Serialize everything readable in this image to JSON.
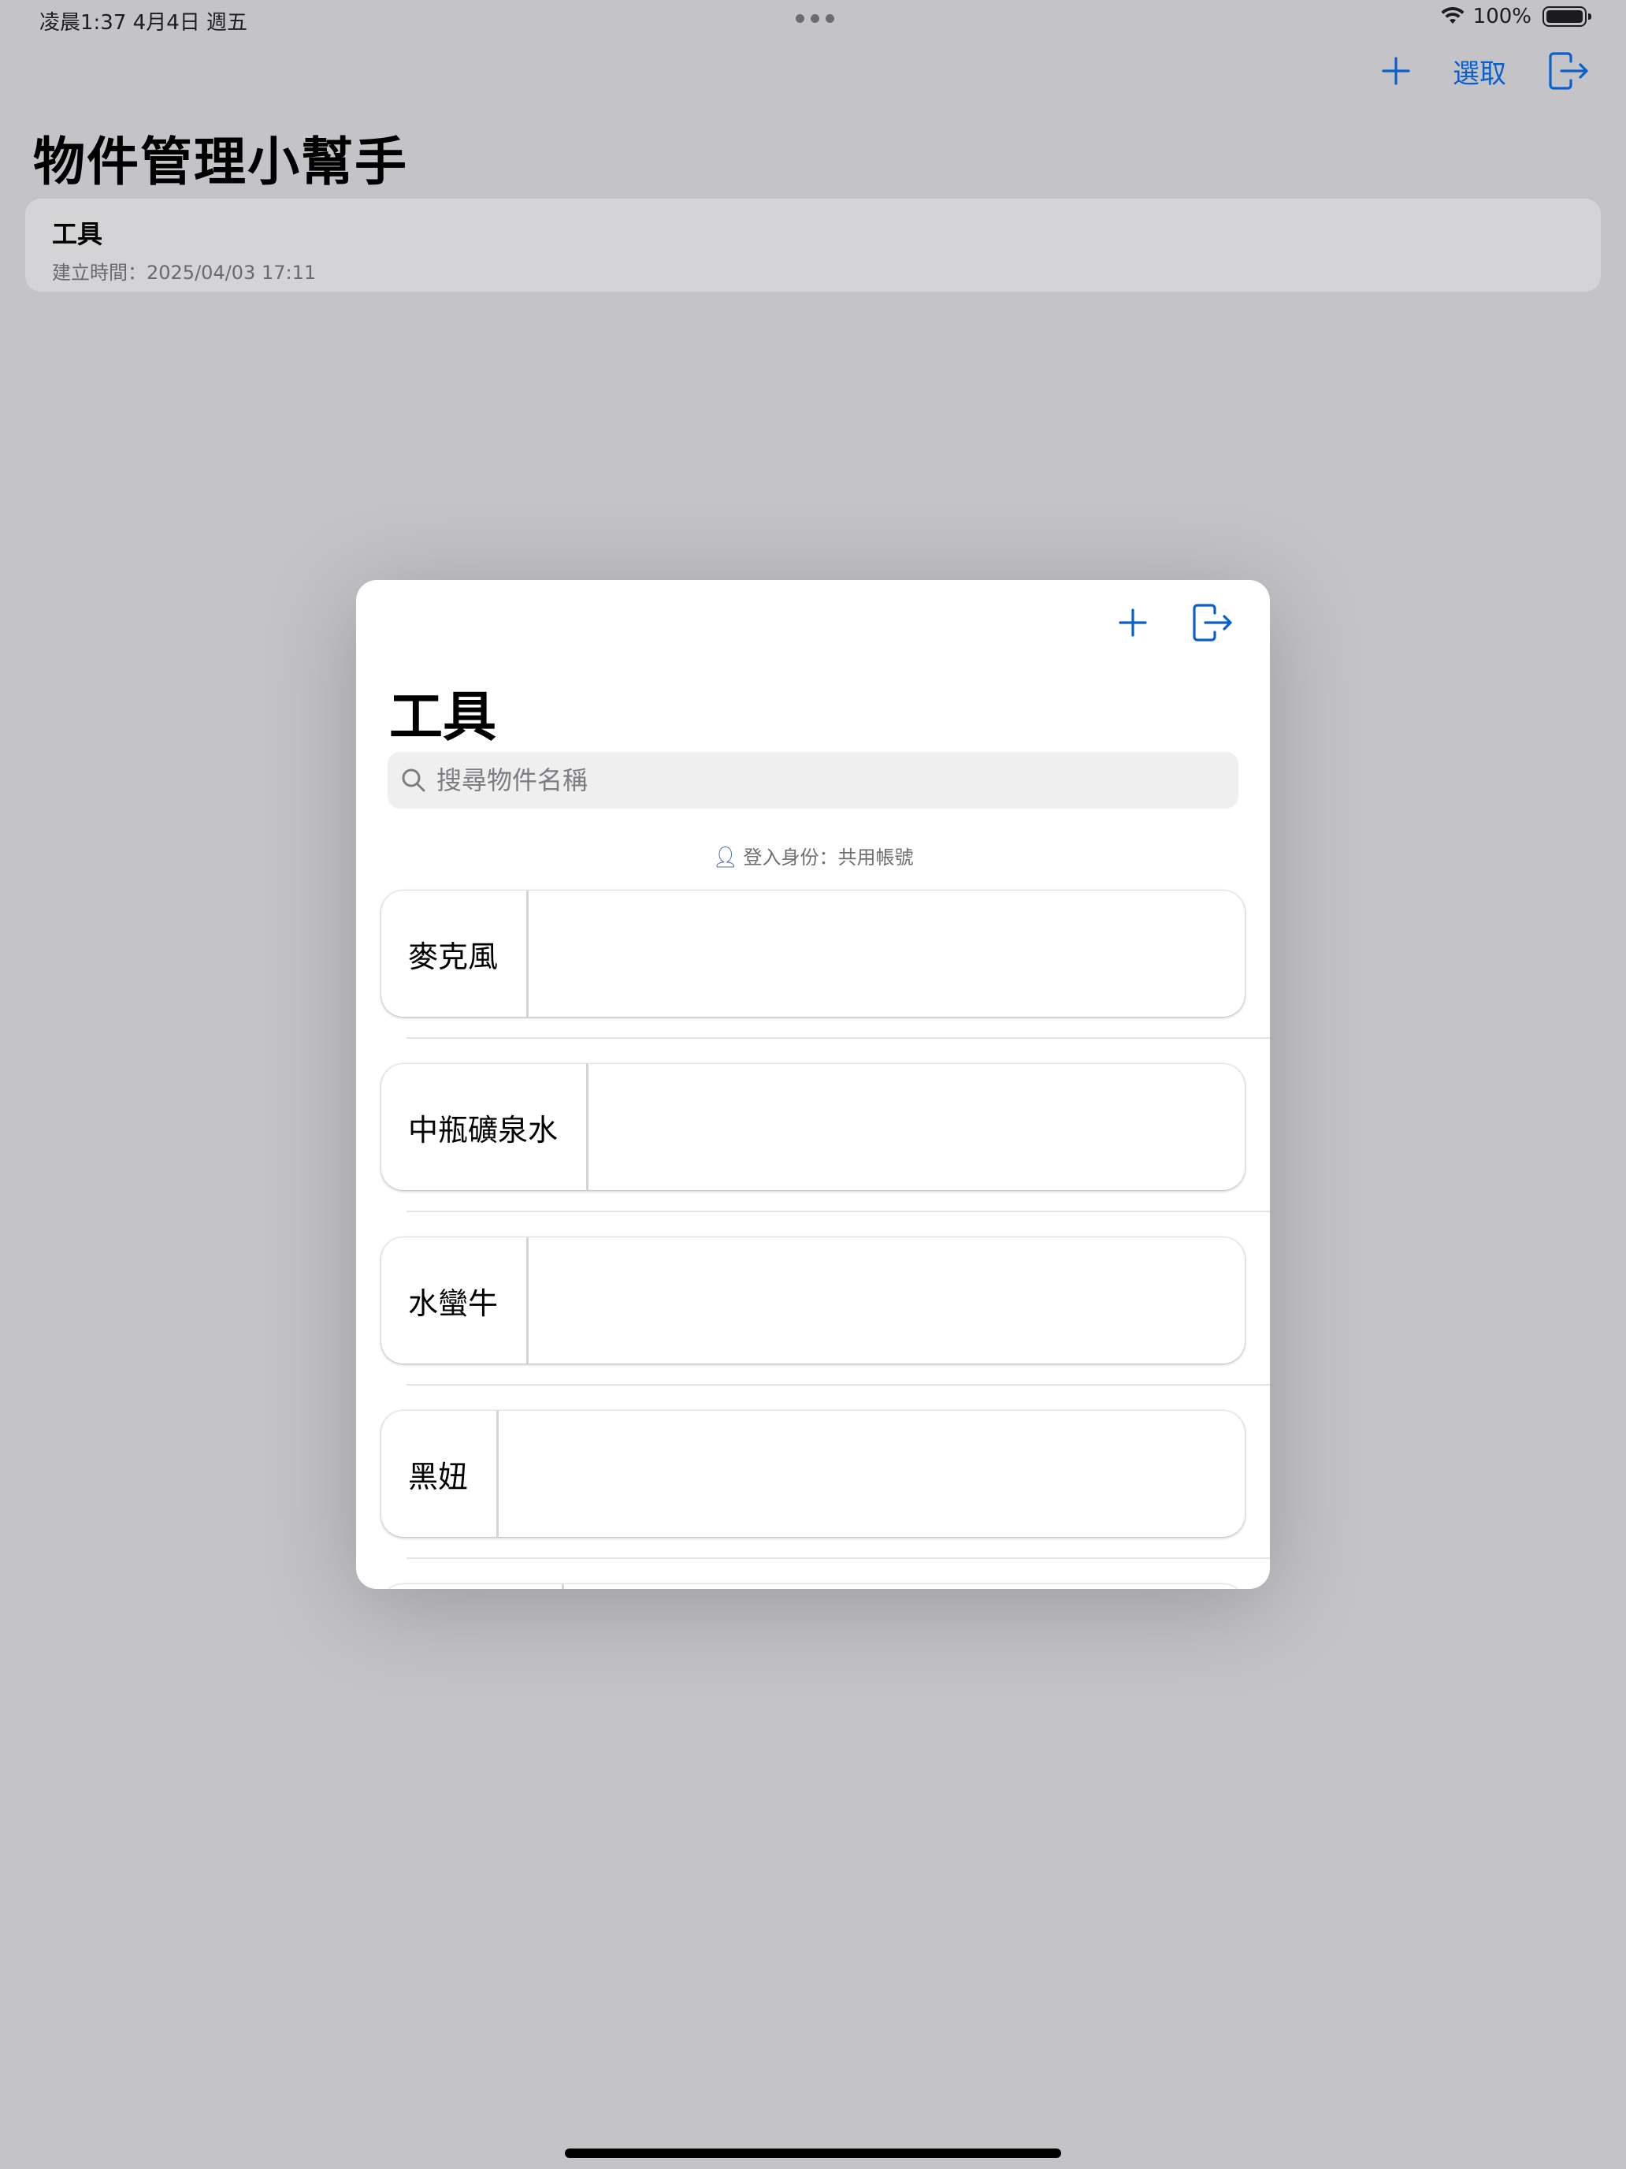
{
  "status_bar": {
    "time": "凌晨1:37   4月4日 週五",
    "battery": "100%"
  },
  "background": {
    "toolbar": {
      "select_label": "選取"
    },
    "title": "物件管理小幫手",
    "card": {
      "title": "工具",
      "subtitle": "建立時間：2025/04/03 17:11"
    }
  },
  "sheet": {
    "title": "工具",
    "search_placeholder": "搜尋物件名稱",
    "login_info": "登入身份：共用帳號",
    "items": [
      {
        "name": "麥克風"
      },
      {
        "name": "中瓶礦泉水"
      },
      {
        "name": "水蠻牛"
      },
      {
        "name": "黑妞"
      },
      {
        "name": ""
      }
    ]
  },
  "colors": {
    "accent": "#0a60c8",
    "background": "#c4c4c8",
    "sheet": "#ffffff"
  }
}
